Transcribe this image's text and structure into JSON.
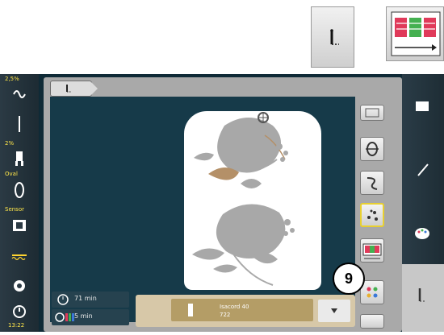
{
  "left_bar": {
    "items": [
      {
        "label": "2,5%",
        "icon": "bobbin-thread-icon"
      },
      {
        "label": "",
        "icon": "needle-icon"
      },
      {
        "label": "2%",
        "icon": "presser-foot-icon"
      },
      {
        "label": "Oval",
        "icon": "hoop-icon"
      },
      {
        "label": "Sensor",
        "icon": "feed-dog-icon"
      },
      {
        "label": "",
        "icon": "thread-tension-icon"
      },
      {
        "label": "",
        "icon": "settings-gear-icon"
      },
      {
        "label": "13:22",
        "icon": "clock-icon"
      }
    ]
  },
  "main": {
    "tab_icon": "stitch-path-icon",
    "info": {
      "time_row": "71 min",
      "colors_row": "5 min"
    },
    "color_bar": {
      "thread_name": "Isacord 40",
      "thread_code": "722"
    }
  },
  "toolbar": {
    "buttons": [
      {
        "name": "edit",
        "icon": "grid-icon"
      },
      {
        "name": "loop",
        "icon": "loop-icon"
      },
      {
        "name": "thread-cut",
        "icon": "scissors-icon"
      },
      {
        "name": "move",
        "icon": "arrows-icon",
        "active": true
      },
      {
        "name": "color-sequence",
        "icon": "color-blocks-icon"
      },
      {
        "name": "color-mix",
        "icon": "color-dots-icon"
      }
    ]
  },
  "right_bar": {
    "icons": [
      "folder-icon",
      "pen-icon",
      "palette-icon"
    ],
    "bottom_icon": "stitch-path-icon"
  },
  "callout": {
    "number": "9"
  },
  "colors": {
    "screen_bg": "#0f2a36",
    "design_bg": "#163a49",
    "accent": "#e8d030",
    "flower_gray": "#a8a8a8",
    "flower_tan": "#b49068"
  }
}
